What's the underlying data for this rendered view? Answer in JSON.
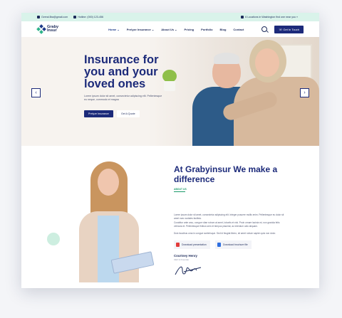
{
  "topbar": {
    "email": "Overal.Bra@gmail.com",
    "phone": "Hotline: (000) 123-456",
    "locations": "6 Locations in Washington find one near you »"
  },
  "brand": {
    "line1": "Graby",
    "line2": "Insur"
  },
  "nav": {
    "items": [
      "Home",
      "Prelyze Insurance",
      "About Us",
      "Pricing",
      "Portfolio",
      "Blog",
      "Contact"
    ],
    "chevrons": [
      true,
      true,
      true,
      false,
      false,
      false,
      false
    ],
    "cta_label": "Get In Touch"
  },
  "hero": {
    "title": "Insurance for you and your loved ones",
    "subtitle": "Lorem ipsum dolor sit amet, consectetur adipiscing elit. Pellentesque eu neque, commodo et magna",
    "primary_button": "Prelyze Insurance",
    "secondary_button": "Get A Quote",
    "prev_arrow": "‹",
    "next_arrow": "›"
  },
  "about": {
    "title": "At Grabyinsur We make a difference",
    "tag": "ABOUT US",
    "paragraphs": [
      "Lorem ipsum dolor sit amet, consectetur adipiscing elit. Integer posuere mollis enim. Pellentesque eu dolor sit amet nunc sodales facilisis.",
      "Curabitur ante arcu, congue vitae rutrum at amet, lobortis et nisi. Proin ornare lacinia mi, non gravida felis vehicula et. Pellentesque finibus sem et tempus placerat, ac interdum odio aliquam.",
      "Duis faucibus urna in congue scelerisque. Sed id feugiat libero, sit amet rutrum sapien quis non dolor."
    ],
    "downloads": [
      {
        "label": "Download presentation",
        "icon": "pdf-file-icon",
        "color": "#e23b3b"
      },
      {
        "label": "Download brochure file",
        "icon": "doc-file-icon",
        "color": "#2f6fe0"
      }
    ],
    "signer_name": "Courtney Henry",
    "signer_role": "CEO & Founder"
  },
  "colors": {
    "primary": "#1c2a7a",
    "accent": "#1c9a6a",
    "topbar_bg": "#d9f3ea",
    "hero_bg": "#f7f3ef"
  }
}
